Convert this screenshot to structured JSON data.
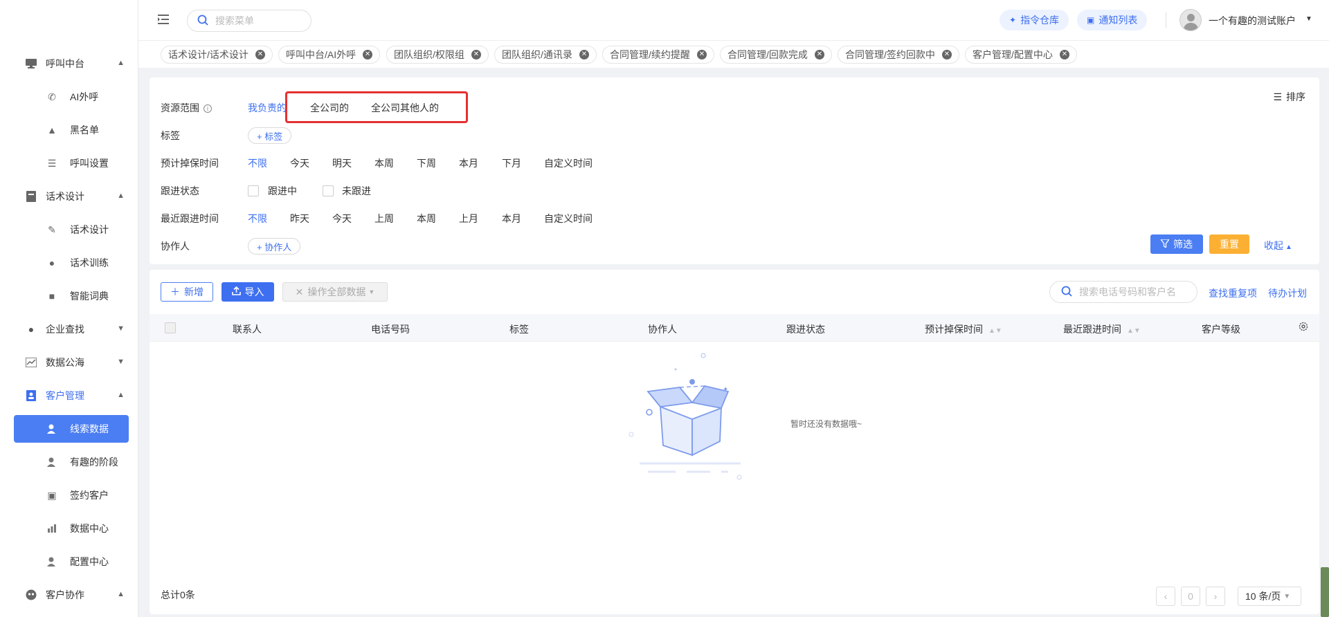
{
  "header": {
    "search_placeholder": "搜索菜单",
    "btn_commands": "指令仓库",
    "btn_notifications": "通知列表",
    "account_name": "一个有趣的测试账户"
  },
  "sidebar": {
    "groups": [
      {
        "label": "呼叫中台"
      },
      {
        "label": "话术设计"
      },
      {
        "label": "企业查找"
      },
      {
        "label": "数据公海"
      },
      {
        "label": "客户管理"
      },
      {
        "label": "客户协作"
      }
    ],
    "items": [
      {
        "label": "AI外呼"
      },
      {
        "label": "黑名单"
      },
      {
        "label": "呼叫设置"
      },
      {
        "label": "话术设计"
      },
      {
        "label": "话术训练"
      },
      {
        "label": "智能词典"
      },
      {
        "label": "线索数据"
      },
      {
        "label": "有趣的阶段"
      },
      {
        "label": "签约客户"
      },
      {
        "label": "数据中心"
      },
      {
        "label": "配置中心"
      }
    ]
  },
  "tabs": [
    {
      "label": "话术设计/话术设计"
    },
    {
      "label": "呼叫中台/AI外呼"
    },
    {
      "label": "团队组织/权限组"
    },
    {
      "label": "团队组织/通讯录"
    },
    {
      "label": "合同管理/续约提醒"
    },
    {
      "label": "合同管理/回款完成"
    },
    {
      "label": "合同管理/签约回款中"
    },
    {
      "label": "客户管理/配置中心"
    }
  ],
  "filter": {
    "sort_label": "排序",
    "scope": {
      "label": "资源范围",
      "options": [
        "我负责的",
        "全公司的",
        "全公司其他人的"
      ],
      "selected": "我负责的"
    },
    "tag": {
      "label": "标签",
      "add": "+ 标签"
    },
    "expected_drop": {
      "label": "预计掉保时间",
      "options": [
        "不限",
        "今天",
        "明天",
        "本周",
        "下周",
        "本月",
        "下月",
        "自定义时间"
      ],
      "selected": "不限"
    },
    "follow_status": {
      "label": "跟进状态",
      "options": [
        "跟进中",
        "未跟进"
      ]
    },
    "recent_follow": {
      "label": "最近跟进时间",
      "options": [
        "不限",
        "昨天",
        "今天",
        "上周",
        "本周",
        "上月",
        "本月",
        "自定义时间"
      ],
      "selected": "不限"
    },
    "collaborator": {
      "label": "协作人",
      "add": "+ 协作人"
    },
    "btn_filter": "筛选",
    "btn_reset": "重置",
    "btn_collapse": "收起"
  },
  "table": {
    "btn_new": "新增",
    "btn_import": "导入",
    "btn_ops": "操作全部数据",
    "search_placeholder": "搜索电话号码和客户名",
    "link_duplicates": "查找重复项",
    "link_todo": "待办计划",
    "columns": [
      "联系人",
      "电话号码",
      "标签",
      "协作人",
      "跟进状态",
      "预计掉保时间",
      "最近跟进时间",
      "客户等级"
    ],
    "empty_text": "暂时还没有数据哦~",
    "total": "总计0条",
    "page": "0",
    "page_size": "10 条/页"
  },
  "colors": {
    "primary": "#3d6ff0",
    "reset": "#fbb033",
    "highlight_box": "#e53030"
  }
}
